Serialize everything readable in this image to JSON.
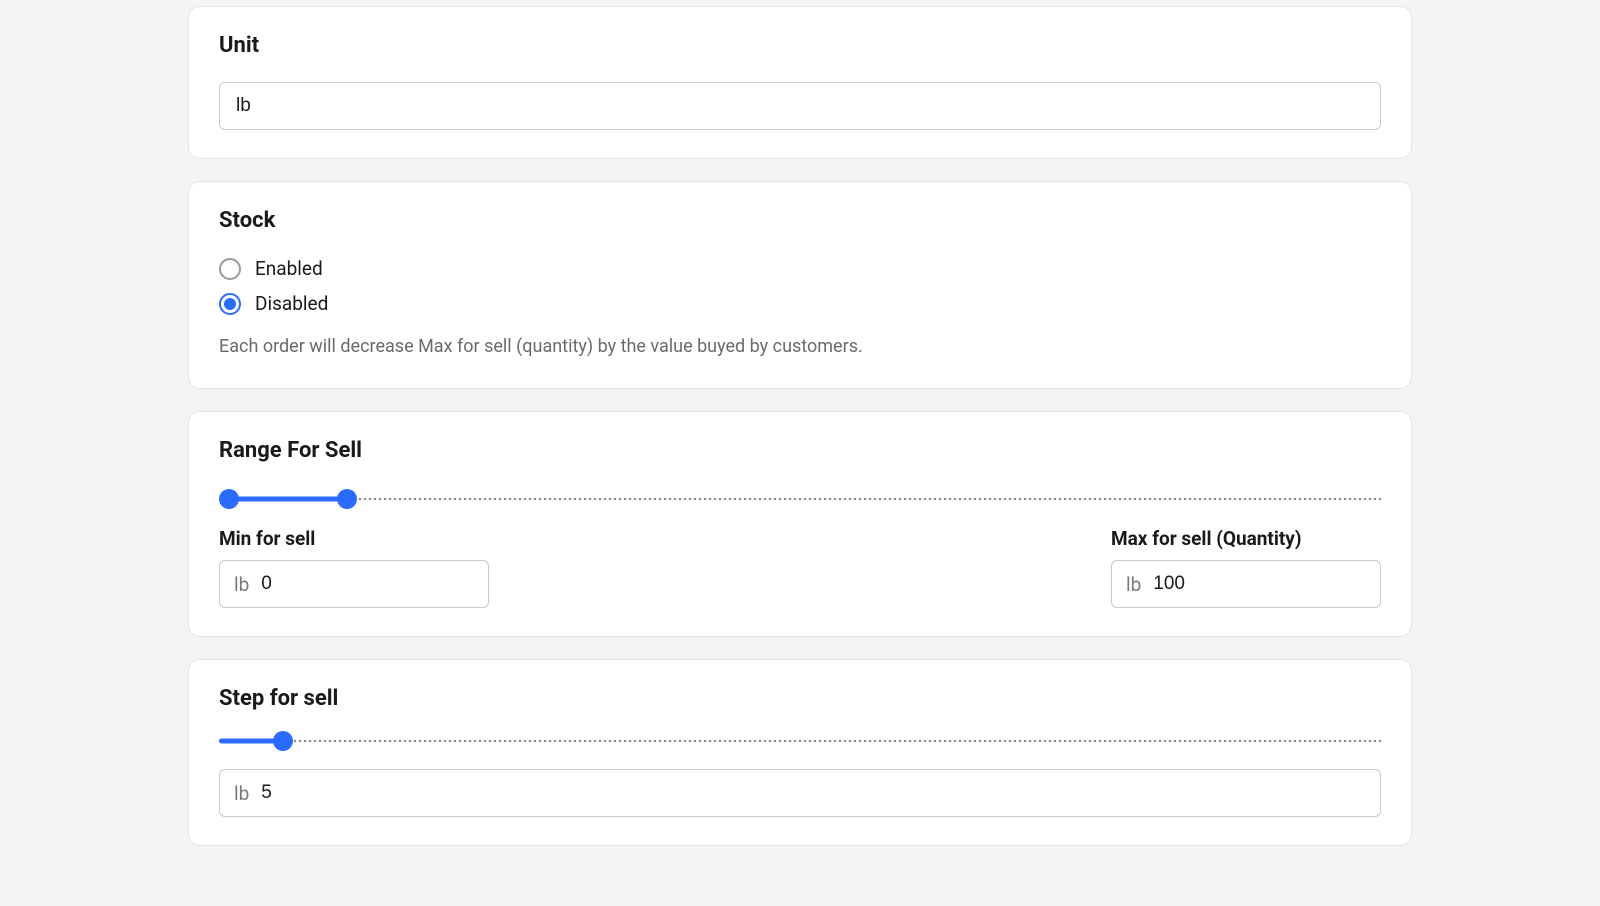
{
  "unit": {
    "title": "Unit",
    "value": "lb"
  },
  "stock": {
    "title": "Stock",
    "options": {
      "enabled": "Enabled",
      "disabled": "Disabled"
    },
    "selected": "disabled",
    "help": "Each order will decrease Max for sell (quantity) by the value buyed by customers."
  },
  "range": {
    "title": "Range For Sell",
    "min_label": "Min for sell",
    "max_label": "Max for sell (Quantity)",
    "unit_prefix": "lb",
    "min_value": "0",
    "max_value": "100",
    "slider": {
      "left_pct": 0,
      "right_pct": 11
    }
  },
  "step": {
    "title": "Step for sell",
    "unit_prefix": "lb",
    "value": "5",
    "slider": {
      "fill_pct": 5.5
    }
  }
}
